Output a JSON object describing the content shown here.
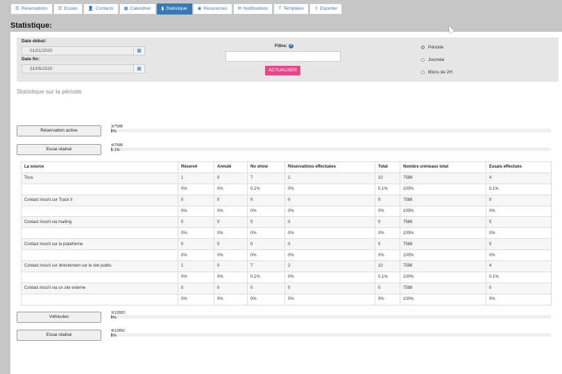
{
  "tabs": [
    {
      "label": "Réservations",
      "icon": "list-icon",
      "glyph": "☰",
      "active": false
    },
    {
      "label": "Essais",
      "icon": "list-icon",
      "glyph": "☰",
      "active": false
    },
    {
      "label": "Contacts",
      "icon": "user-icon",
      "glyph": "👤",
      "active": false
    },
    {
      "label": "Calendrier",
      "icon": "calendar-icon",
      "glyph": "▦",
      "active": false
    },
    {
      "label": "Statistique",
      "icon": "bar-chart-icon",
      "glyph": "▮",
      "active": true
    },
    {
      "label": "Ressources",
      "icon": "globe-icon",
      "glyph": "◉",
      "active": false
    },
    {
      "label": "Notifications",
      "icon": "envelope-icon",
      "glyph": "✉",
      "active": false
    },
    {
      "label": "Templates",
      "icon": "text-icon",
      "glyph": "T",
      "active": false
    },
    {
      "label": "Exporter",
      "icon": "export-icon",
      "glyph": "⇪",
      "active": false
    }
  ],
  "page_title": "Statistique:",
  "filters": {
    "start_label": "Date début:",
    "start_value": "01/01/2020",
    "end_label": "Date fin:",
    "end_value": "31/05/2020",
    "filter_label": "Filtre:",
    "filter_value": "",
    "refresh_label": "ACTUALISER",
    "options": [
      {
        "label": "Période",
        "selected": true
      },
      {
        "label": "Journée",
        "selected": false
      },
      {
        "label": "Blocs de 2H",
        "selected": false
      }
    ]
  },
  "subtitle": "Statistique sur la période",
  "stat_blocks_top": [
    {
      "button": "Réservation active",
      "count": "3/7588",
      "percent": "0%",
      "fraction": 0.0004
    },
    {
      "button": "Essai réalisé",
      "count": "4/7588",
      "percent": "0.1%",
      "fraction": 0.0005
    }
  ],
  "table": {
    "headers": [
      "La source",
      "Réservé",
      "Annulé",
      "No show",
      "Réservations effectuées",
      "Total",
      "Nombre créneaux total",
      "Essais effectués"
    ],
    "rows": [
      {
        "main": [
          "Tous",
          "1",
          "0",
          "7",
          "2",
          "10",
          "7588",
          "4"
        ],
        "pct": [
          "",
          "0%",
          "0%",
          "0.1%",
          "0%",
          "0.1%",
          "100%",
          "0.1%"
        ]
      },
      {
        "main": [
          "Contact inscrit sur Track It",
          "0",
          "0",
          "0",
          "0",
          "0",
          "7588",
          "0"
        ],
        "pct": [
          "",
          "0%",
          "0%",
          "0%",
          "0%",
          "0%",
          "100%",
          "0%"
        ]
      },
      {
        "main": [
          "Contact inscrit via mailing",
          "0",
          "0",
          "0",
          "0",
          "0",
          "7588",
          "0"
        ],
        "pct": [
          "",
          "0%",
          "0%",
          "0%",
          "0%",
          "0%",
          "100%",
          "0%"
        ]
      },
      {
        "main": [
          "Contact inscrit sur la plateforme",
          "0",
          "0",
          "0",
          "0",
          "0",
          "7588",
          "0"
        ],
        "pct": [
          "",
          "0%",
          "0%",
          "0%",
          "0%",
          "0%",
          "100%",
          "0%"
        ]
      },
      {
        "main": [
          "Contact inscrit sur directement sur le site public",
          "1",
          "0",
          "7",
          "2",
          "10",
          "7588",
          "4"
        ],
        "pct": [
          "",
          "0%",
          "0%",
          "0.1%",
          "0%",
          "0.1%",
          "100%",
          "0.1%"
        ]
      },
      {
        "main": [
          "Contact inscrit via un site externe",
          "0",
          "0",
          "0",
          "0",
          "0",
          "7588",
          "0"
        ],
        "pct": [
          "",
          "0%",
          "0%",
          "0%",
          "0%",
          "0%",
          "100%",
          "0%"
        ]
      }
    ]
  },
  "stat_blocks_bottom": [
    {
      "button": "Véhicules",
      "count": "3/12892",
      "percent": "0%",
      "fraction": 0.0002
    },
    {
      "button": "Essai réalisé",
      "count": "4/12892",
      "percent": "0%",
      "fraction": 0.0003
    }
  ],
  "colors": {
    "accent": "#337ab7",
    "button_pink": "#e8488a",
    "background": "#c6c6c6"
  }
}
